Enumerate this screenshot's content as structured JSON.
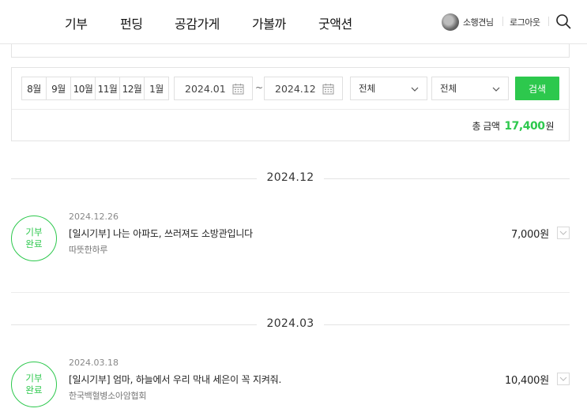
{
  "nav": {
    "items": [
      "기부",
      "펀딩",
      "공감가게",
      "가볼까",
      "굿액션"
    ]
  },
  "user": {
    "name": "소행견님",
    "logout_label": "로그아웃"
  },
  "filter": {
    "months": [
      "8월",
      "9월",
      "10월",
      "11월",
      "12월",
      "1월"
    ],
    "start_date": "2024.01",
    "end_date": "2024.12",
    "range_separator": "~",
    "select1_value": "전체",
    "select2_value": "전체",
    "search_label": "검색",
    "total_label": "총 금액",
    "total_amount": "17,400",
    "total_unit": "원"
  },
  "sections": [
    {
      "month": "2024.12",
      "items": [
        {
          "status_line1": "기부",
          "status_line2": "완료",
          "date": "2024.12.26",
          "title": "[일시기부] 나는 아파도, 쓰러져도 소방관입니다",
          "org": "따뜻한하루",
          "amount": "7,000원"
        }
      ]
    },
    {
      "month": "2024.03",
      "items": [
        {
          "status_line1": "기부",
          "status_line2": "완료",
          "date": "2024.03.18",
          "title": "[일시기부] 엄마, 하늘에서 우리 막내 세은이 꼭 지켜줘.",
          "org": "한국백혈병소아암협회",
          "amount": "10,400원"
        }
      ]
    }
  ],
  "colors": {
    "accent": "#2dc84d",
    "border": "#e3e3e3"
  }
}
